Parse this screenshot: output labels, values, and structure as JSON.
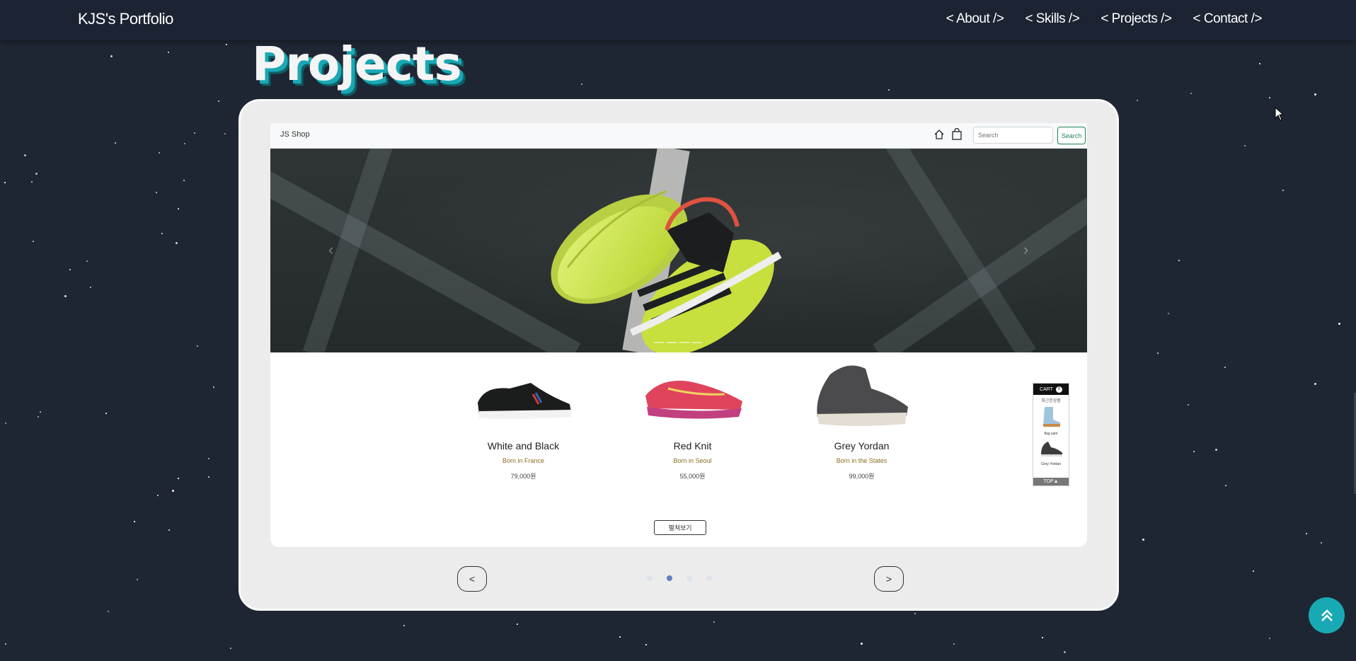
{
  "header": {
    "brand": "KJS's Portfolio",
    "nav": [
      "< About />",
      "< Skills />",
      "< Projects />",
      "< Contact />"
    ]
  },
  "section": {
    "title": "Projects"
  },
  "shop": {
    "brand": "JS Shop",
    "search_placeholder": "Search",
    "search_button": "Search",
    "products": [
      {
        "name": "White and Black",
        "origin": "Born in France",
        "price": "79,000원"
      },
      {
        "name": "Red Knit",
        "origin": "Born in Seoul",
        "price": "55,000원"
      },
      {
        "name": "Grey Yordan",
        "origin": "Born in the States",
        "price": "99,000원"
      }
    ],
    "more_button": "펼쳐보기",
    "cart": {
      "title": "CART",
      "count": "0",
      "subtitle": "최근본상품",
      "items": [
        "flag sam",
        "Grey Yordan"
      ],
      "top_label": "TOP▲"
    }
  },
  "pager": {
    "prev": "<",
    "next": ">",
    "active_index": 1,
    "total": 4
  },
  "colors": {
    "background": "#1f2633",
    "accent": "#19a9b5",
    "active_dot": "#5f7fbf"
  }
}
